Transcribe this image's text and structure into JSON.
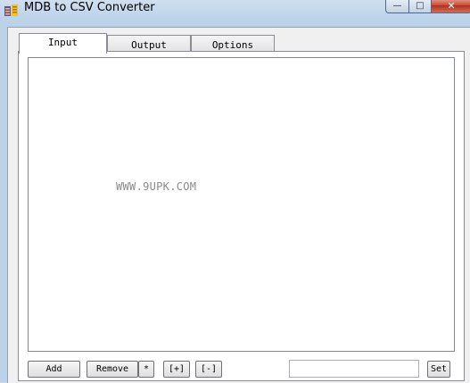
{
  "window": {
    "title": "MDB to CSV Converter",
    "controls": {
      "minimize": "—",
      "maximize": "□",
      "close": "✕"
    }
  },
  "tabs": [
    {
      "label": "Input",
      "active": true
    },
    {
      "label": "Output",
      "active": false
    },
    {
      "label": "Options",
      "active": false
    }
  ],
  "input_panel": {
    "file_list": [],
    "watermark": "WWW.9UPK.COM"
  },
  "buttons": {
    "add": "Add",
    "remove": "Remove",
    "star": "*",
    "plus": "[+]",
    "minus": "[-]",
    "set": "Set"
  },
  "set_field": {
    "value": "",
    "placeholder": ""
  },
  "icons": {
    "app": "database-convert-icon",
    "minimize": "minimize-icon",
    "maximize": "maximize-icon",
    "close": "close-icon"
  },
  "colors": {
    "frame": "#bcd2e8",
    "client": "#f0f0f0",
    "close_button": "#c74a34"
  }
}
